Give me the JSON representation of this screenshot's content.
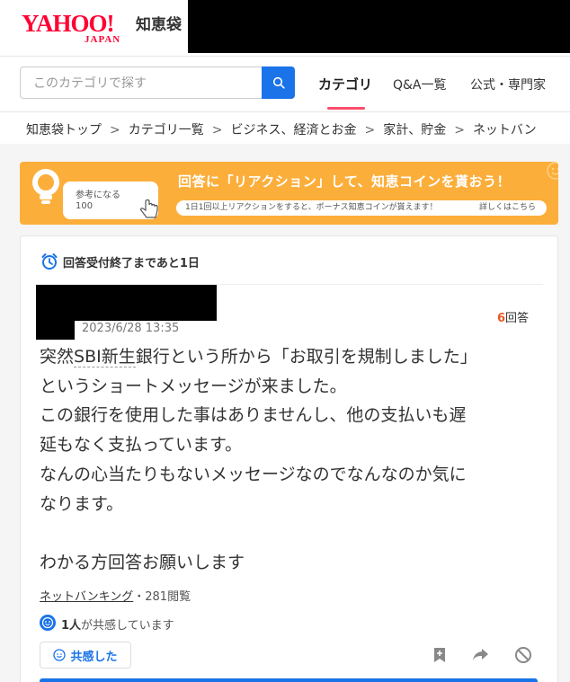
{
  "header": {
    "logo_main": "YAHOO!",
    "logo_sub": "JAPAN",
    "service_name": "知恵袋"
  },
  "search": {
    "placeholder": "このカテゴリで探す"
  },
  "nav": {
    "tabs": [
      {
        "label": "カテゴリ",
        "active": true
      },
      {
        "label": "Q&A一覧",
        "active": false
      },
      {
        "label": "公式・専門家",
        "active": false
      }
    ]
  },
  "breadcrumb": [
    "知恵袋トップ",
    "カテゴリ一覧",
    "ビジネス、経済とお金",
    "家計、貯金",
    "ネットバン"
  ],
  "banner": {
    "pill_line1": "参考になる",
    "pill_line2": "100",
    "title": "回答に「リアクション」して、知恵コインを貰おう！",
    "subtitle": "1日1回以上リアクションをすると、ボーナス知恵コインが貰えます！",
    "details_link": "詳しくはこちら"
  },
  "question": {
    "deadline": "回答受付終了まであと1日",
    "date": "2023/6/28 13:35",
    "answer_count": "6",
    "answer_unit": "回答",
    "body_lines": [
      "突然SBI新生銀行という所から「お取引を規制しました」",
      "というショートメッセージが来ました。",
      "この銀行を使用した事はありませんし、他の支払いも遅",
      "延もなく支払っています。",
      "なんの心当たりもないメッセージなのでなんなのか気に",
      "なります。",
      "",
      "わかる方回答お願いします"
    ],
    "category": "ネットバンキング",
    "views": "・281閲覧",
    "empathy_count": "1人",
    "empathy_text": "が共感しています",
    "empathy_button": "共感した"
  },
  "colors": {
    "brand_red": "#ff0033",
    "accent_blue": "#1a73e8",
    "tab_underline": "#ff4c6a",
    "banner_orange": "#fcae3b",
    "answer_count": "#e95a27"
  }
}
